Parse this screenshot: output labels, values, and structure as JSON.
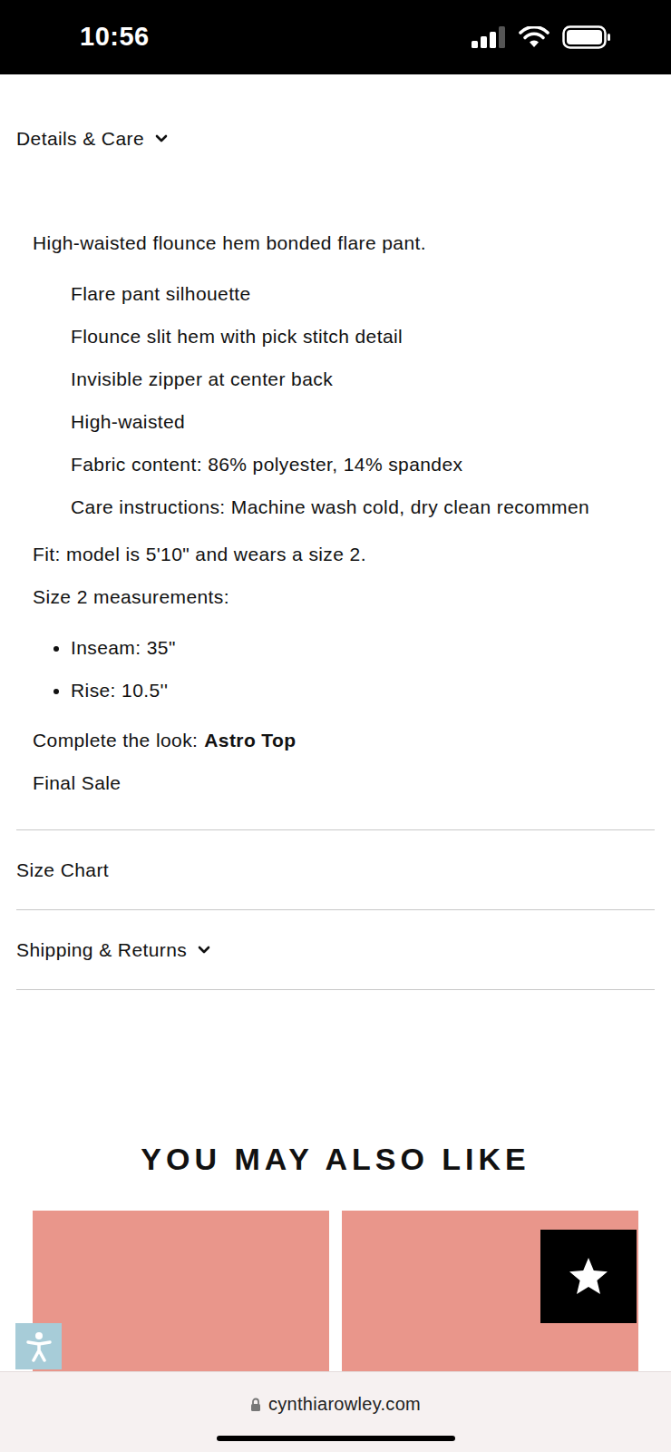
{
  "status_bar": {
    "time": "10:56"
  },
  "details": {
    "heading": "Details & Care",
    "expanded": true,
    "description": "High-waisted flounce hem bonded flare pant.",
    "bullets": [
      "Flare pant silhouette",
      "Flounce slit hem with pick stitch detail",
      "Invisible zipper at center back",
      "High-waisted",
      "Fabric content: 86% polyester, 14% spandex",
      "Care instructions: Machine wash cold, dry clean recommen"
    ],
    "fit": "Fit: model is 5'10\" and wears a size 2.",
    "measurements_title": "Size 2 measurements:",
    "measurements": [
      "Inseam: 35\"",
      "Rise: 10.5''"
    ],
    "complete_label": "Complete the look:",
    "complete_link": "Astro Top",
    "final_sale": "Final Sale"
  },
  "sections": [
    {
      "label": "Size Chart",
      "kind": "link"
    },
    {
      "label": "Shipping & Returns",
      "kind": "accordion",
      "expanded": false
    }
  ],
  "recommendations": {
    "title": "YOU MAY ALSO LIKE",
    "products": [
      {
        "kind": "photo"
      },
      {
        "kind": "photo"
      }
    ]
  },
  "browser": {
    "url": "cynthiarowley.com"
  }
}
